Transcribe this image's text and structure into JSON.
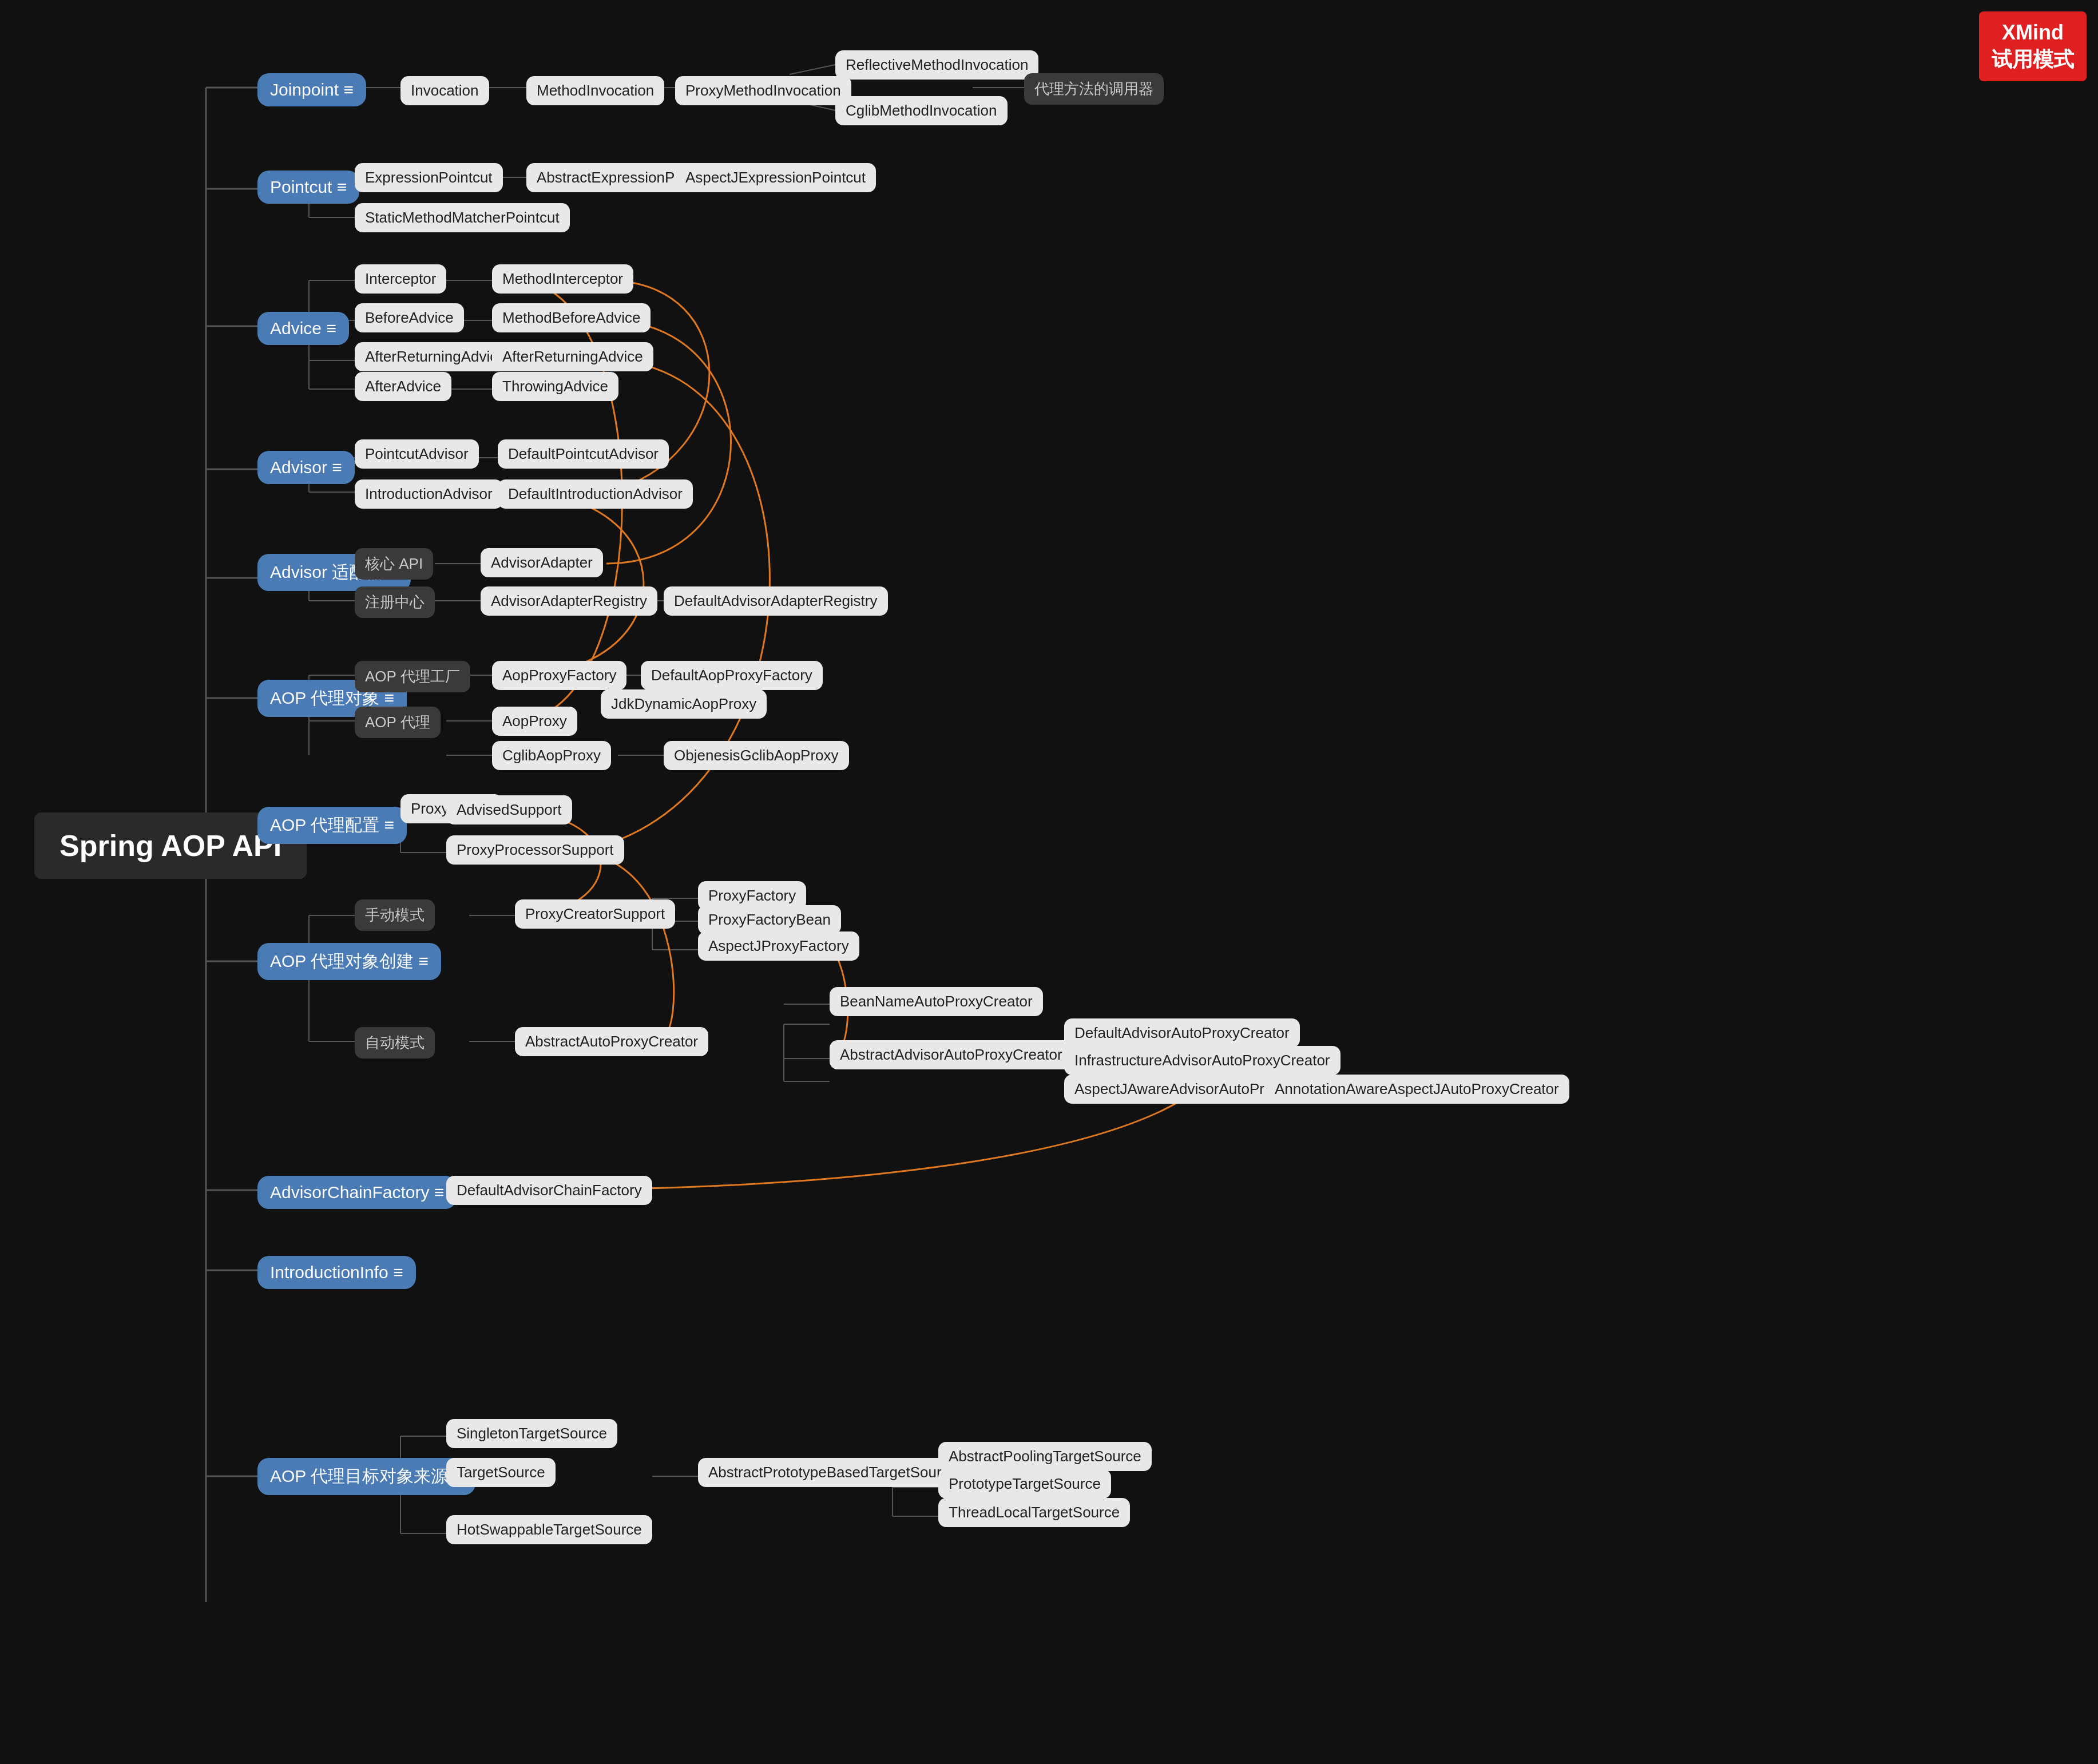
{
  "app": {
    "title": "Spring AOP API",
    "badge_line1": "XMind",
    "badge_line2": "试用模式"
  },
  "nodes": {
    "main": "Spring AOP API",
    "joinpoint": "Joinpoint  ≡",
    "pointcut": "Pointcut  ≡",
    "advice": "Advice  ≡",
    "advisor": "Advisor  ≡",
    "advisor_adapter": "Advisor 适配器  ≡",
    "aop_proxy_obj": "AOP 代理对象  ≡",
    "aop_proxy_config": "AOP 代理配置  ≡",
    "aop_proxy_create": "AOP 代理对象创建  ≡",
    "advisor_chain_factory": "AdvisorChainFactory  ≡",
    "introduction_info": "IntroductionInfo  ≡",
    "aop_target_source": "AOP 代理目标对象来源  ≡"
  }
}
